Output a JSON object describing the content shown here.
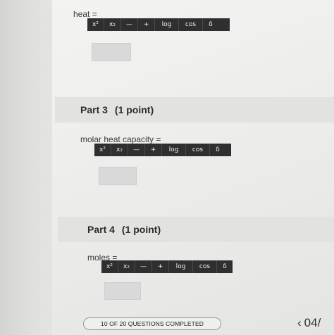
{
  "toolbar_buttons": [
    "x²",
    "x₂",
    "—",
    "+",
    "log",
    "cos",
    "δ"
  ],
  "part2": {
    "field_label": "heat ="
  },
  "part3": {
    "title": "Part 3",
    "points": "(1 point)",
    "field_label": "molar heat capacity ="
  },
  "part4": {
    "title": "Part 4",
    "points": "(1 point)",
    "field_label": "moles ="
  },
  "footer": {
    "progress_text": "10 OF 20 QUESTIONS COMPLETED",
    "nav_chevron": "‹",
    "nav_page": "04/"
  }
}
